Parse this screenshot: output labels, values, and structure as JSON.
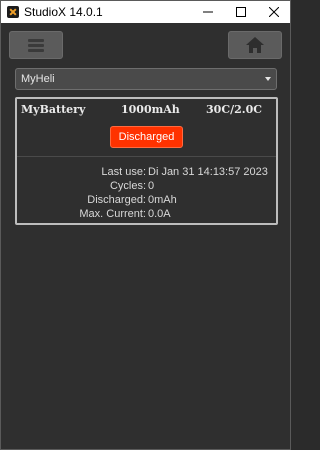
{
  "window": {
    "title": "StudioX 14.0.1",
    "controls": [
      "minimize",
      "maximize",
      "close"
    ]
  },
  "toolbar": {
    "menu_icon": "hamburger-menu-icon",
    "home_icon": "home-icon"
  },
  "model_select": {
    "value": "MyHeli"
  },
  "battery": {
    "name": "MyBattery",
    "capacity": "1000mAh",
    "rating": "30C/2.0C",
    "status": "Discharged",
    "status_color": "#ff3200",
    "details": [
      {
        "label": "Last use:",
        "value": "Di Jan 31 14:13:57 2023"
      },
      {
        "label": "Cycles:",
        "value": "0"
      },
      {
        "label": "Discharged:",
        "value": "0mAh"
      },
      {
        "label": "Max. Current:",
        "value": "0.0A"
      }
    ]
  }
}
